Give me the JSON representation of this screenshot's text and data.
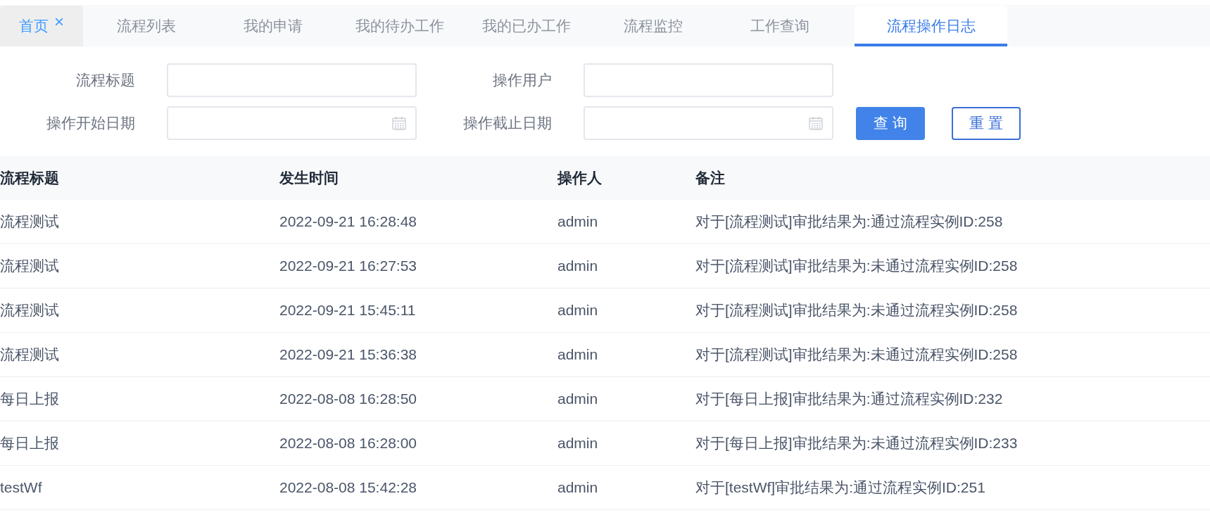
{
  "tabs": [
    {
      "label": "首页",
      "kind": "home",
      "selected": false,
      "close": "×"
    },
    {
      "label": "流程列表",
      "kind": "normal",
      "selected": false
    },
    {
      "label": "我的申请",
      "kind": "normal",
      "selected": false
    },
    {
      "label": "我的待办工作",
      "kind": "normal",
      "selected": false
    },
    {
      "label": "我的已办工作",
      "kind": "normal",
      "selected": false
    },
    {
      "label": "流程监控",
      "kind": "normal",
      "selected": false
    },
    {
      "label": "工作查询",
      "kind": "normal",
      "selected": false
    },
    {
      "label": "流程操作日志",
      "kind": "normal",
      "selected": true
    }
  ],
  "filters": [
    {
      "label": "流程标题",
      "kind": "text"
    },
    {
      "label": "操作用户",
      "kind": "text"
    },
    {
      "label": "操作开始日期",
      "kind": "date"
    },
    {
      "label": "操作截止日期",
      "kind": "date"
    }
  ],
  "buttons": [
    {
      "label": "查询",
      "kind": "primary"
    },
    {
      "label": "重置",
      "kind": "outline"
    }
  ],
  "table": {
    "columns": [
      "流程标题",
      "发生时间",
      "操作人",
      "备注"
    ],
    "rows": [
      [
        "流程测试",
        "2022-09-21 16:28:48",
        "admin",
        "对于[流程测试]审批结果为:通过流程实例ID:258"
      ],
      [
        "流程测试",
        "2022-09-21 16:27:53",
        "admin",
        "对于[流程测试]审批结果为:未通过流程实例ID:258"
      ],
      [
        "流程测试",
        "2022-09-21 15:45:11",
        "admin",
        "对于[流程测试]审批结果为:未通过流程实例ID:258"
      ],
      [
        "流程测试",
        "2022-09-21 15:36:38",
        "admin",
        "对于[流程测试]审批结果为:未通过流程实例ID:258"
      ],
      [
        "每日上报",
        "2022-08-08 16:28:50",
        "admin",
        "对于[每日上报]审批结果为:通过流程实例ID:232"
      ],
      [
        "每日上报",
        "2022-08-08 16:28:00",
        "admin",
        "对于[每日上报]审批结果为:未通过流程实例ID:233"
      ],
      [
        "testWf",
        "2022-08-08 15:42:28",
        "admin",
        "对于[testWf]审批结果为:通过流程实例ID:251"
      ]
    ]
  }
}
